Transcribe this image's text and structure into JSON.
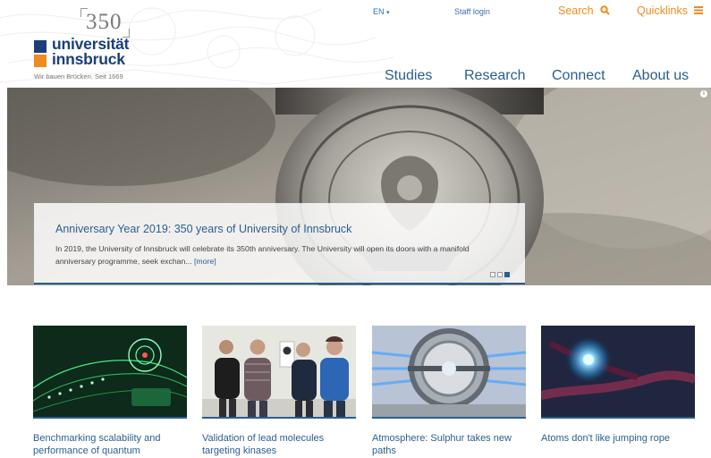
{
  "brand": {
    "anniversary_mark": "350",
    "name_line1": "universität",
    "name_line2": "innsbruck",
    "tagline": "Wir bauen Brücken. Seit 1669",
    "colors": {
      "blue": "#1a3f7a",
      "orange": "#ef8b1e",
      "link": "#2a5f8f"
    }
  },
  "topbar": {
    "language": "EN",
    "language_icon": "chevron-down-icon",
    "staff_login": "Staff login",
    "search_label": "Search",
    "search_icon": "magnifier-icon",
    "quicklinks_label": "Quicklinks",
    "quicklinks_icon": "hamburger-icon"
  },
  "nav": {
    "items": [
      {
        "label": "Studies"
      },
      {
        "label": "Research"
      },
      {
        "label": "Connect"
      },
      {
        "label": "About us"
      }
    ]
  },
  "hero": {
    "title": "Anniversary Year 2019: 350 years of University of Innsbruck",
    "text": "In 2019, the University of Innsbruck will celebrate its 350th anniversary. The University will open its doors with a manifold anniversary programme, seek exchan...",
    "more": "[more]",
    "info_icon": "info-icon",
    "slides": 3,
    "active_slide": 3
  },
  "news": [
    {
      "caption": "Benchmarking scalability and performance of quantum",
      "image": "quantum-network-image"
    },
    {
      "caption": "Validation of lead molecules targeting kinases",
      "image": "research-team-photo"
    },
    {
      "caption": "Atmosphere: Sulphur takes new paths",
      "image": "lab-chamber-image"
    },
    {
      "caption": "Atoms don't like jumping rope",
      "image": "atom-visualization-image"
    }
  ]
}
